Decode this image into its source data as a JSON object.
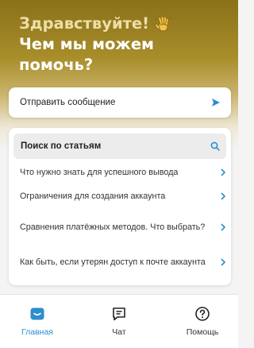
{
  "header": {
    "greeting_line1": "Здравствуйте!",
    "greeting_line2": "Чем мы можем",
    "greeting_line3": "помочь?",
    "wave_icon": "waving-hand-emoji"
  },
  "send_message": {
    "label": "Отправить сообщение",
    "icon": "send-icon"
  },
  "help": {
    "search_label": "Поиск по статьям",
    "search_icon": "search-icon",
    "articles": [
      {
        "title": "Что нужно знать для успешного вывода"
      },
      {
        "title": "Ограничения для создания аккаунта"
      },
      {
        "title": "Сравнения платёжных методов. Что выбрать?"
      },
      {
        "title": "Как быть, если утерян доступ к почте аккаунта"
      }
    ]
  },
  "tabs": [
    {
      "label": "Главная",
      "icon": "home-icon",
      "active": true
    },
    {
      "label": "Чат",
      "icon": "chat-icon",
      "active": false
    },
    {
      "label": "Помощь",
      "icon": "help-icon",
      "active": false
    }
  ],
  "colors": {
    "accent": "#2a8ecf",
    "hero_gold": "#8a7119",
    "greeting_gold": "#ecdfa8"
  }
}
